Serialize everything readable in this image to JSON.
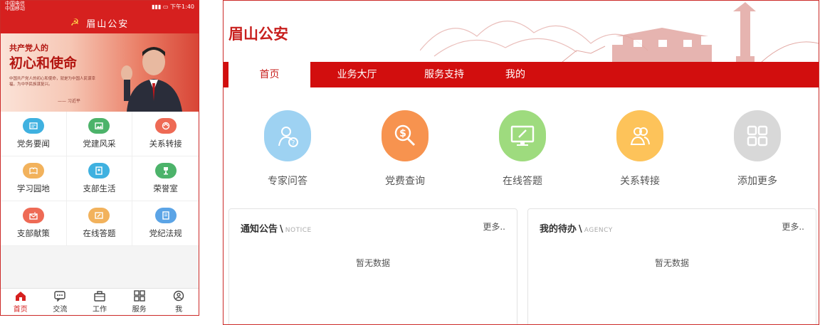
{
  "phone": {
    "status": {
      "carrier1": "中国电信",
      "carrier2": "中国移动",
      "time": "下午1:40"
    },
    "title": "眉山公安",
    "banner": {
      "line1": "共产党人的",
      "line2": "初心和使命",
      "quote": "中国共产党人的初心和使命，就是为中国人民谋幸福，为中华民族谋复兴。",
      "signature": "—— 习近平"
    },
    "grid": [
      {
        "label": "党务要闻",
        "color": "#3fb1e0",
        "icon": "newspaper-icon"
      },
      {
        "label": "党建风采",
        "color": "#4cb36a",
        "icon": "image-icon"
      },
      {
        "label": "关系转接",
        "color": "#ee6a55",
        "icon": "transfer-icon"
      },
      {
        "label": "学习园地",
        "color": "#f2b25c",
        "icon": "book-icon"
      },
      {
        "label": "支部生活",
        "color": "#3fb1e0",
        "icon": "photo-icon"
      },
      {
        "label": "荣誉室",
        "color": "#4cb36a",
        "icon": "trophy-icon"
      },
      {
        "label": "支部献策",
        "color": "#ee6a55",
        "icon": "mailbox-icon"
      },
      {
        "label": "在线答题",
        "color": "#f2b25c",
        "icon": "edit-icon"
      },
      {
        "label": "党纪法规",
        "color": "#5ba4e6",
        "icon": "rules-icon"
      }
    ],
    "tabs": [
      {
        "label": "首页",
        "icon": "home-icon",
        "active": true
      },
      {
        "label": "交流",
        "icon": "chat-icon",
        "active": false
      },
      {
        "label": "工作",
        "icon": "briefcase-icon",
        "active": false
      },
      {
        "label": "服务",
        "icon": "apps-icon",
        "active": false
      },
      {
        "label": "我",
        "icon": "user-icon",
        "active": false
      }
    ]
  },
  "desktop": {
    "logo": "眉山公安",
    "nav": [
      {
        "label": "首页",
        "active": true
      },
      {
        "label": "业务大厅",
        "active": false
      },
      {
        "label": "服务支持",
        "active": false
      },
      {
        "label": "我的",
        "active": false
      }
    ],
    "quick": [
      {
        "label": "专家问答",
        "color": "#9ed2f2",
        "icon": "expert-icon"
      },
      {
        "label": "党费查询",
        "color": "#f7934f",
        "icon": "fee-search-icon"
      },
      {
        "label": "在线答题",
        "color": "#9edb7e",
        "icon": "monitor-edit-icon"
      },
      {
        "label": "关系转接",
        "color": "#fdc35a",
        "icon": "people-icon"
      },
      {
        "label": "添加更多",
        "color": "#d8d8d8",
        "icon": "grid-icon"
      }
    ],
    "notice": {
      "title": "通知公告",
      "en": "NOTICE",
      "more": "更多..",
      "empty": "暂无数据"
    },
    "agency": {
      "title": "我的待办",
      "en": "AGENCY",
      "more": "更多..",
      "empty": "暂无数据"
    }
  }
}
